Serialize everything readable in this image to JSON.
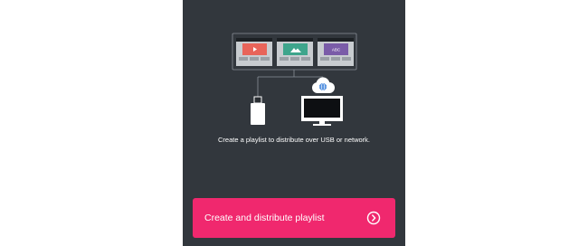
{
  "colors": {
    "panel_background": "#32373d",
    "accent": "#f0286e",
    "slide_red": "#e8645a",
    "slide_green": "#3ea58c",
    "slide_purple": "#7a5ca8",
    "globe_blue": "#1f6fd6"
  },
  "illustration": {
    "slides": [
      {
        "icon": "play-icon"
      },
      {
        "icon": "mountain-icon"
      },
      {
        "icon": "abc-text-icon",
        "text": "ABC"
      }
    ],
    "targets": [
      "usb-drive-icon",
      "monitor-icon",
      "cloud-globe-icon"
    ]
  },
  "caption": "Create a playlist to distribute over USB or network.",
  "cta": {
    "label": "Create and distribute playlist",
    "icon": "arrow-circle-right-icon"
  }
}
